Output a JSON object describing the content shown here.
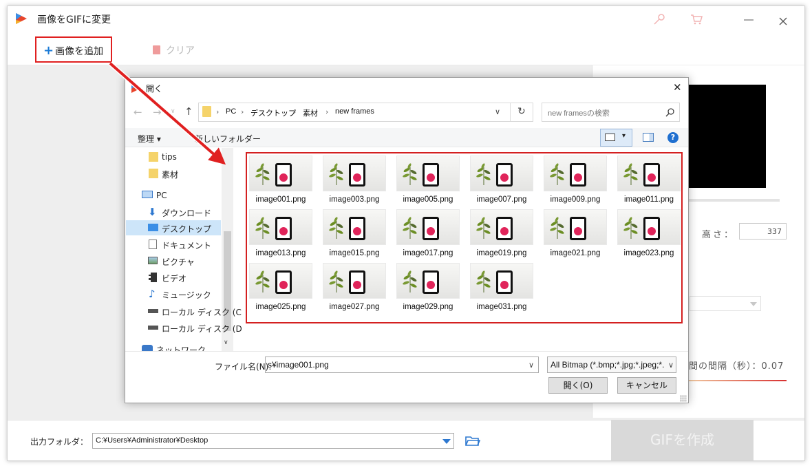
{
  "app": {
    "title": "画像をGIFに変更",
    "colors": {
      "accent_red": "#e02020",
      "blue": "#1a7ad6"
    }
  },
  "toolbar": {
    "add_image_label": "画像を追加",
    "clear_label": "クリア"
  },
  "settings": {
    "height_label": "高さ：",
    "height_value": "337",
    "interval_label": "間の間隔（秒）：0.07"
  },
  "output": {
    "folder_label": "出力フォルダ：",
    "folder_path": "C:¥Users¥Administrator¥Desktop",
    "make_gif_label": "GIFを作成"
  },
  "dialog": {
    "title": "開く",
    "breadcrumb": [
      "PC",
      "デスクトップ",
      "素材",
      "new frames"
    ],
    "search_placeholder": "new framesの検索",
    "organize_label": "整理 ▾",
    "new_folder_label": "新しいフォルダー",
    "nav_items": [
      "tips",
      "素材",
      "PC",
      "ダウンロード",
      "デスクトップ",
      "ドキュメント",
      "ピクチャ",
      "ビデオ",
      "ミュージック",
      "ローカル ディスク (C",
      "ローカル ディスク (D",
      "ネットワーク"
    ],
    "files": [
      "image001.png",
      "image003.png",
      "image005.png",
      "image007.png",
      "image009.png",
      "image011.png",
      "image013.png",
      "image015.png",
      "image017.png",
      "image019.png",
      "image021.png",
      "image023.png",
      "image025.png",
      "image027.png",
      "image029.png",
      "image031.png"
    ],
    "filename_label": "ファイル名(N):",
    "filename_value": "s¥image001.png",
    "filetype_value": "All Bitmap (*.bmp;*.jpg;*.jpeg;*.",
    "open_button": "開く(O)",
    "cancel_button": "キャンセル"
  }
}
